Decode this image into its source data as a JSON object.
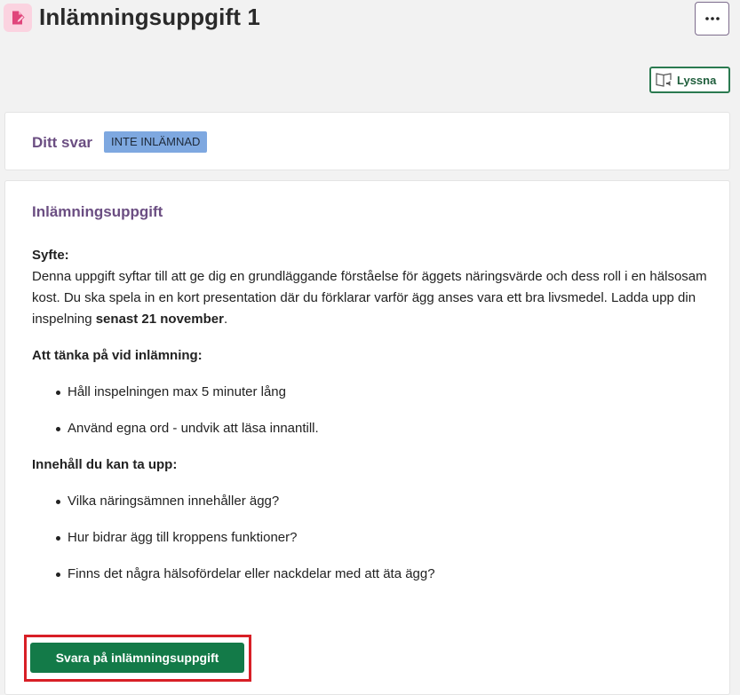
{
  "header": {
    "title": "Inlämningsuppgift 1",
    "title_icon": "document-edit-icon",
    "more_icon": "ellipsis-icon"
  },
  "toolbar": {
    "listen_label": "Lyssna",
    "listen_icon": "read-aloud-icon"
  },
  "answer": {
    "label": "Ditt svar",
    "status": "INTE INLÄMNAD"
  },
  "task": {
    "heading": "Inlämningsuppgift",
    "purpose_title": "Syfte:",
    "purpose_text": "Denna uppgift syftar till att ge dig en grundläggande förståelse för äggets näringsvärde och dess roll i en hälsosam kost. Du ska spela in en kort presentation där du förklarar varför ägg anses vara ett bra livsmedel. Ladda upp din inspelning ",
    "purpose_deadline": "senast 21 november",
    "purpose_end": ".",
    "submission_title": "Att tänka på vid inlämning:",
    "submission_items": [
      "Håll inspelningen max 5 minuter lång",
      "Använd egna ord - undvik att läsa innantill."
    ],
    "content_title": "Innehåll du kan ta upp:",
    "content_items": [
      "Vilka näringsämnen innehåller ägg?",
      "Hur bidrar ägg till kroppens funktioner?",
      "Finns det några hälsofördelar eller nackdelar med att äta ägg?"
    ]
  },
  "actions": {
    "submit_label": "Svara på inlämningsuppgift"
  },
  "colors": {
    "accent_purple": "#6b4e82",
    "primary_green": "#137a48",
    "status_blue": "#7ea8e0",
    "highlight_red": "#d81f26"
  }
}
